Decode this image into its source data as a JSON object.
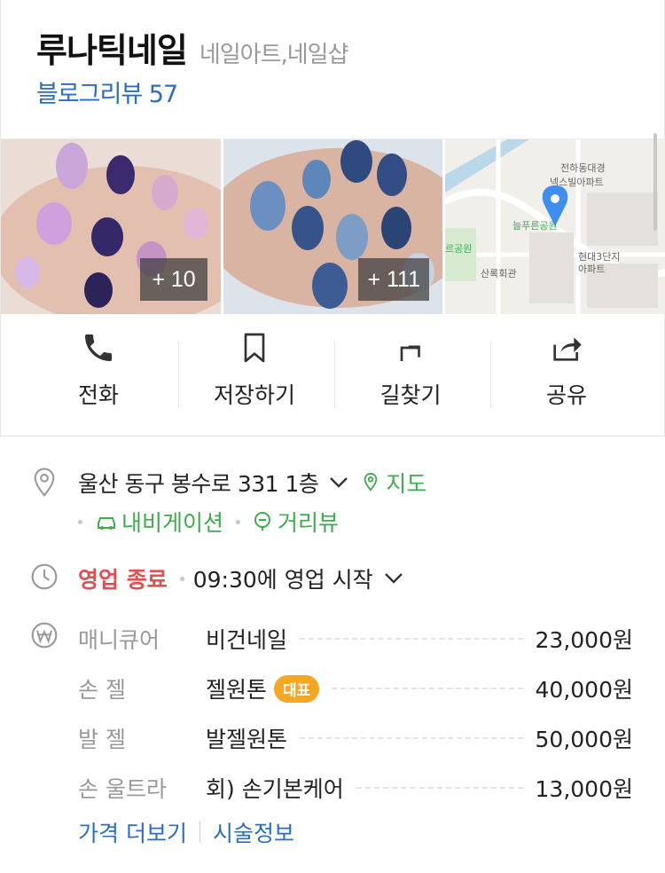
{
  "header": {
    "name": "루나틱네일",
    "category": "네일아트,네일샵",
    "review_link": "블로그리뷰 57"
  },
  "photos": [
    {
      "kind": "nail-photo-glitter",
      "count_label": "+ 10"
    },
    {
      "kind": "nail-photo-navy",
      "count_label": "+ 111"
    },
    {
      "kind": "map-thumbnail",
      "map_labels": [
        "전하동대경",
        "넥스빌아파트",
        "늘푸른공원",
        "산록회관",
        "현대3단지",
        "아파트",
        "르공원"
      ]
    }
  ],
  "actions": [
    {
      "label": "전화",
      "icon": "phone-icon"
    },
    {
      "label": "저장하기",
      "icon": "bookmark-icon"
    },
    {
      "label": "길찾기",
      "icon": "directions-icon"
    },
    {
      "label": "공유",
      "icon": "share-icon"
    }
  ],
  "address": {
    "text": "울산 동구 봉수로 331 1층",
    "map_label": "지도",
    "navigation_label": "내비게이션",
    "streetview_label": "거리뷰"
  },
  "hours": {
    "status": "영업 종료",
    "next": "09:30에 영업 시작"
  },
  "prices": [
    {
      "category": "매니큐어",
      "name": "비건네일",
      "badge": "",
      "price": "23,000원"
    },
    {
      "category": "손 젤",
      "name": "젤원톤",
      "badge": "대표",
      "price": "40,000원"
    },
    {
      "category": "발 젤",
      "name": "발젤원톤",
      "badge": "",
      "price": "50,000원"
    },
    {
      "category": "손 울트라",
      "name": "회) 손기본케어",
      "badge": "",
      "price": "13,000원"
    }
  ],
  "links": {
    "more_prices": "가격 더보기",
    "treatment_info": "시술정보"
  },
  "colors": {
    "link_blue": "#2a6dc4",
    "green": "#3cad4c",
    "closed_red": "#e05050",
    "badge_orange": "#f5a623",
    "map_pin": "#3d8ef0"
  }
}
